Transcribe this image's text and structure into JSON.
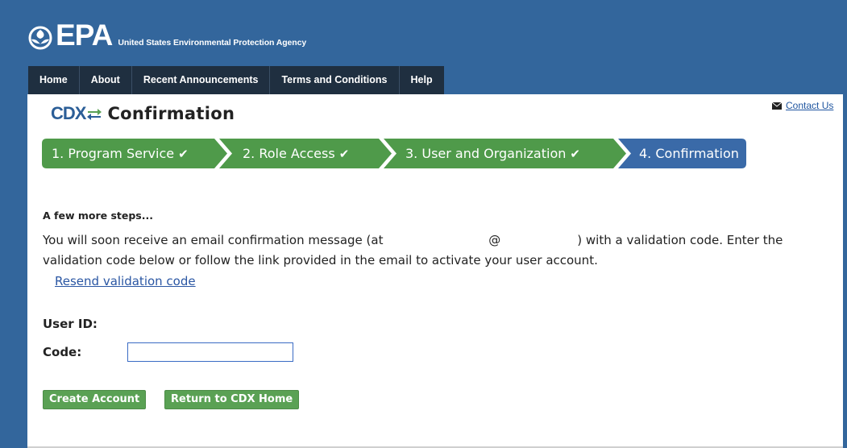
{
  "header": {
    "logo_text": "EPA",
    "agency_name": "United States Environmental Protection Agency",
    "nav": [
      {
        "label": "Home"
      },
      {
        "label": "About"
      },
      {
        "label": "Recent Announcements"
      },
      {
        "label": "Terms and Conditions"
      },
      {
        "label": "Help"
      }
    ]
  },
  "title_bar": {
    "cdx_logo_text": "CDX",
    "page_title": "Confirmation",
    "contact_label": "Contact Us",
    "contact_icon": "envelope-icon"
  },
  "steps": [
    {
      "label": "1. Program Service",
      "completed": true,
      "color": "#4f9a4a"
    },
    {
      "label": "2. Role Access",
      "completed": true,
      "color": "#4f9a4a"
    },
    {
      "label": "3. User and Organization",
      "completed": true,
      "color": "#4f9a4a"
    },
    {
      "label": "4. Confirmation",
      "completed": false,
      "color": "#3a6aa8"
    }
  ],
  "main": {
    "heading": "A few more steps...",
    "message_part1": "You will soon receive an email confirmation message (at",
    "message_at": "@",
    "message_part2": ") with a validation code. Enter the validation code below or follow the link provided in the email to activate your user account.",
    "resend_link": "Resend validation code",
    "user_id_label": "User ID:",
    "code_label": "Code:",
    "code_value": "",
    "create_button": "Create Account",
    "return_button": "Return to CDX Home"
  },
  "colors": {
    "banner": "#33669c",
    "nav_bg": "#1f2f40",
    "step_done": "#4f9a4a",
    "step_current": "#3a6aa8",
    "button_green": "#5aa154",
    "link": "#2a56a3"
  }
}
